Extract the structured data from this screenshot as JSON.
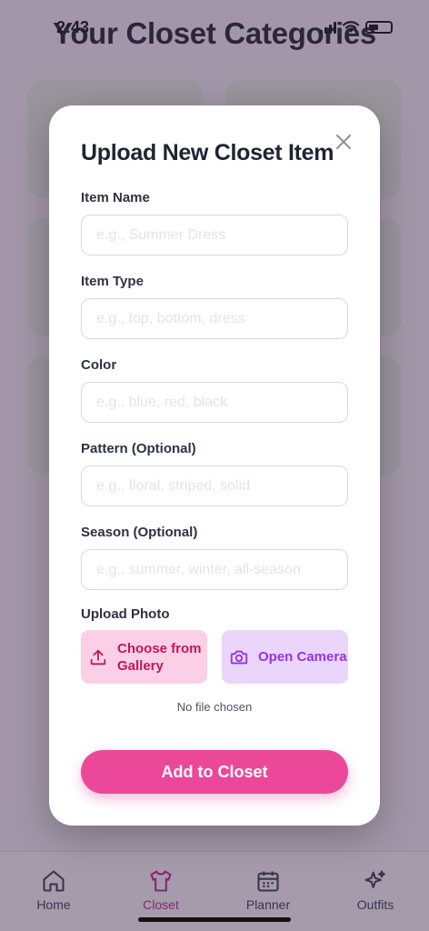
{
  "status_bar": {
    "time": "2:43"
  },
  "background": {
    "title": "Your Closet Categories"
  },
  "modal": {
    "title": "Upload New Closet Item",
    "fields": [
      {
        "label": "Item Name",
        "placeholder": "e.g., Summer Dress",
        "value": ""
      },
      {
        "label": "Item Type",
        "placeholder": "e.g., top, bottom, dress",
        "value": ""
      },
      {
        "label": "Color",
        "placeholder": "e.g., blue, red, black",
        "value": ""
      },
      {
        "label": "Pattern (Optional)",
        "placeholder": "e.g., floral, striped, solid",
        "value": ""
      },
      {
        "label": "Season (Optional)",
        "placeholder": "e.g., summer, winter, all-season",
        "value": ""
      }
    ],
    "upload": {
      "label": "Upload Photo",
      "gallery_button": "Choose from Gallery",
      "camera_button": "Open Camera",
      "file_status": "No file chosen"
    },
    "submit_label": "Add to Closet"
  },
  "tabbar": {
    "tabs": [
      {
        "label": "Home",
        "icon": "home-icon"
      },
      {
        "label": "Closet",
        "icon": "shirt-icon",
        "active": true
      },
      {
        "label": "Planner",
        "icon": "calendar-icon"
      },
      {
        "label": "Outfits",
        "icon": "sparkles-icon"
      }
    ]
  },
  "colors": {
    "accent": "#ec4899",
    "gallery_bg": "#fbcfe6",
    "camera_bg": "#ead5fb",
    "active_tab": "#c026a0"
  }
}
